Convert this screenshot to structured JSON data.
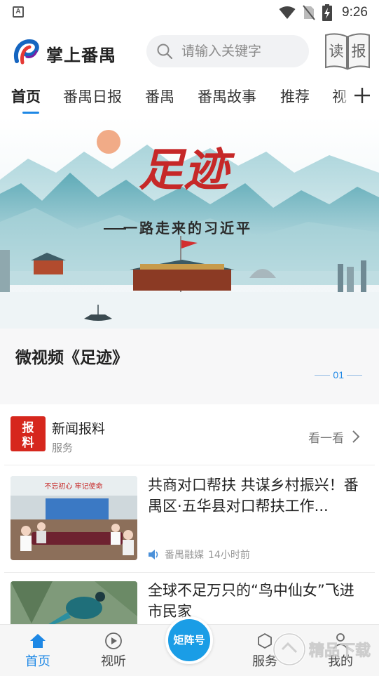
{
  "status_bar": {
    "time": "9:26",
    "notification_letter": "A"
  },
  "header": {
    "app_name": "掌上番禺",
    "search_placeholder": "请输入关键字",
    "read_paper": [
      "读",
      "报"
    ]
  },
  "tabs": [
    {
      "label": "首页",
      "active": true
    },
    {
      "label": "番禺日报"
    },
    {
      "label": "番禺"
    },
    {
      "label": "番禺故事"
    },
    {
      "label": "推荐"
    },
    {
      "label": "视"
    }
  ],
  "banner": {
    "art_title": "足迹",
    "art_subtitle": "一路走来的习近平",
    "caption": "微视频《足迹》",
    "slide_index": "01"
  },
  "report": {
    "icon_text": [
      "报",
      "料"
    ],
    "title": "新闻报料",
    "subtitle": "服务",
    "action": "看一看"
  },
  "news": [
    {
      "title": "共商对口帮扶 共谋乡村振兴！番禺区·五华县对口帮扶工作...",
      "source": "番禺融媒",
      "time": "14小时前",
      "thumb_banner": "不忘初心 牢记使命"
    },
    {
      "title": "全球不足万只的“鸟中仙女”飞进市民家"
    }
  ],
  "bottom_nav": {
    "items": [
      {
        "label": "首页",
        "icon": "home-icon",
        "active": true
      },
      {
        "label": "视听",
        "icon": "play-icon"
      },
      {
        "label": "服务",
        "icon": "service-icon"
      },
      {
        "label": "我的",
        "icon": "user-icon"
      }
    ],
    "center": "矩阵号"
  },
  "colors": {
    "accent": "#1e88e5",
    "report_red": "#d6271d",
    "center_button": "#1a9de6"
  },
  "watermark": "精品下载"
}
